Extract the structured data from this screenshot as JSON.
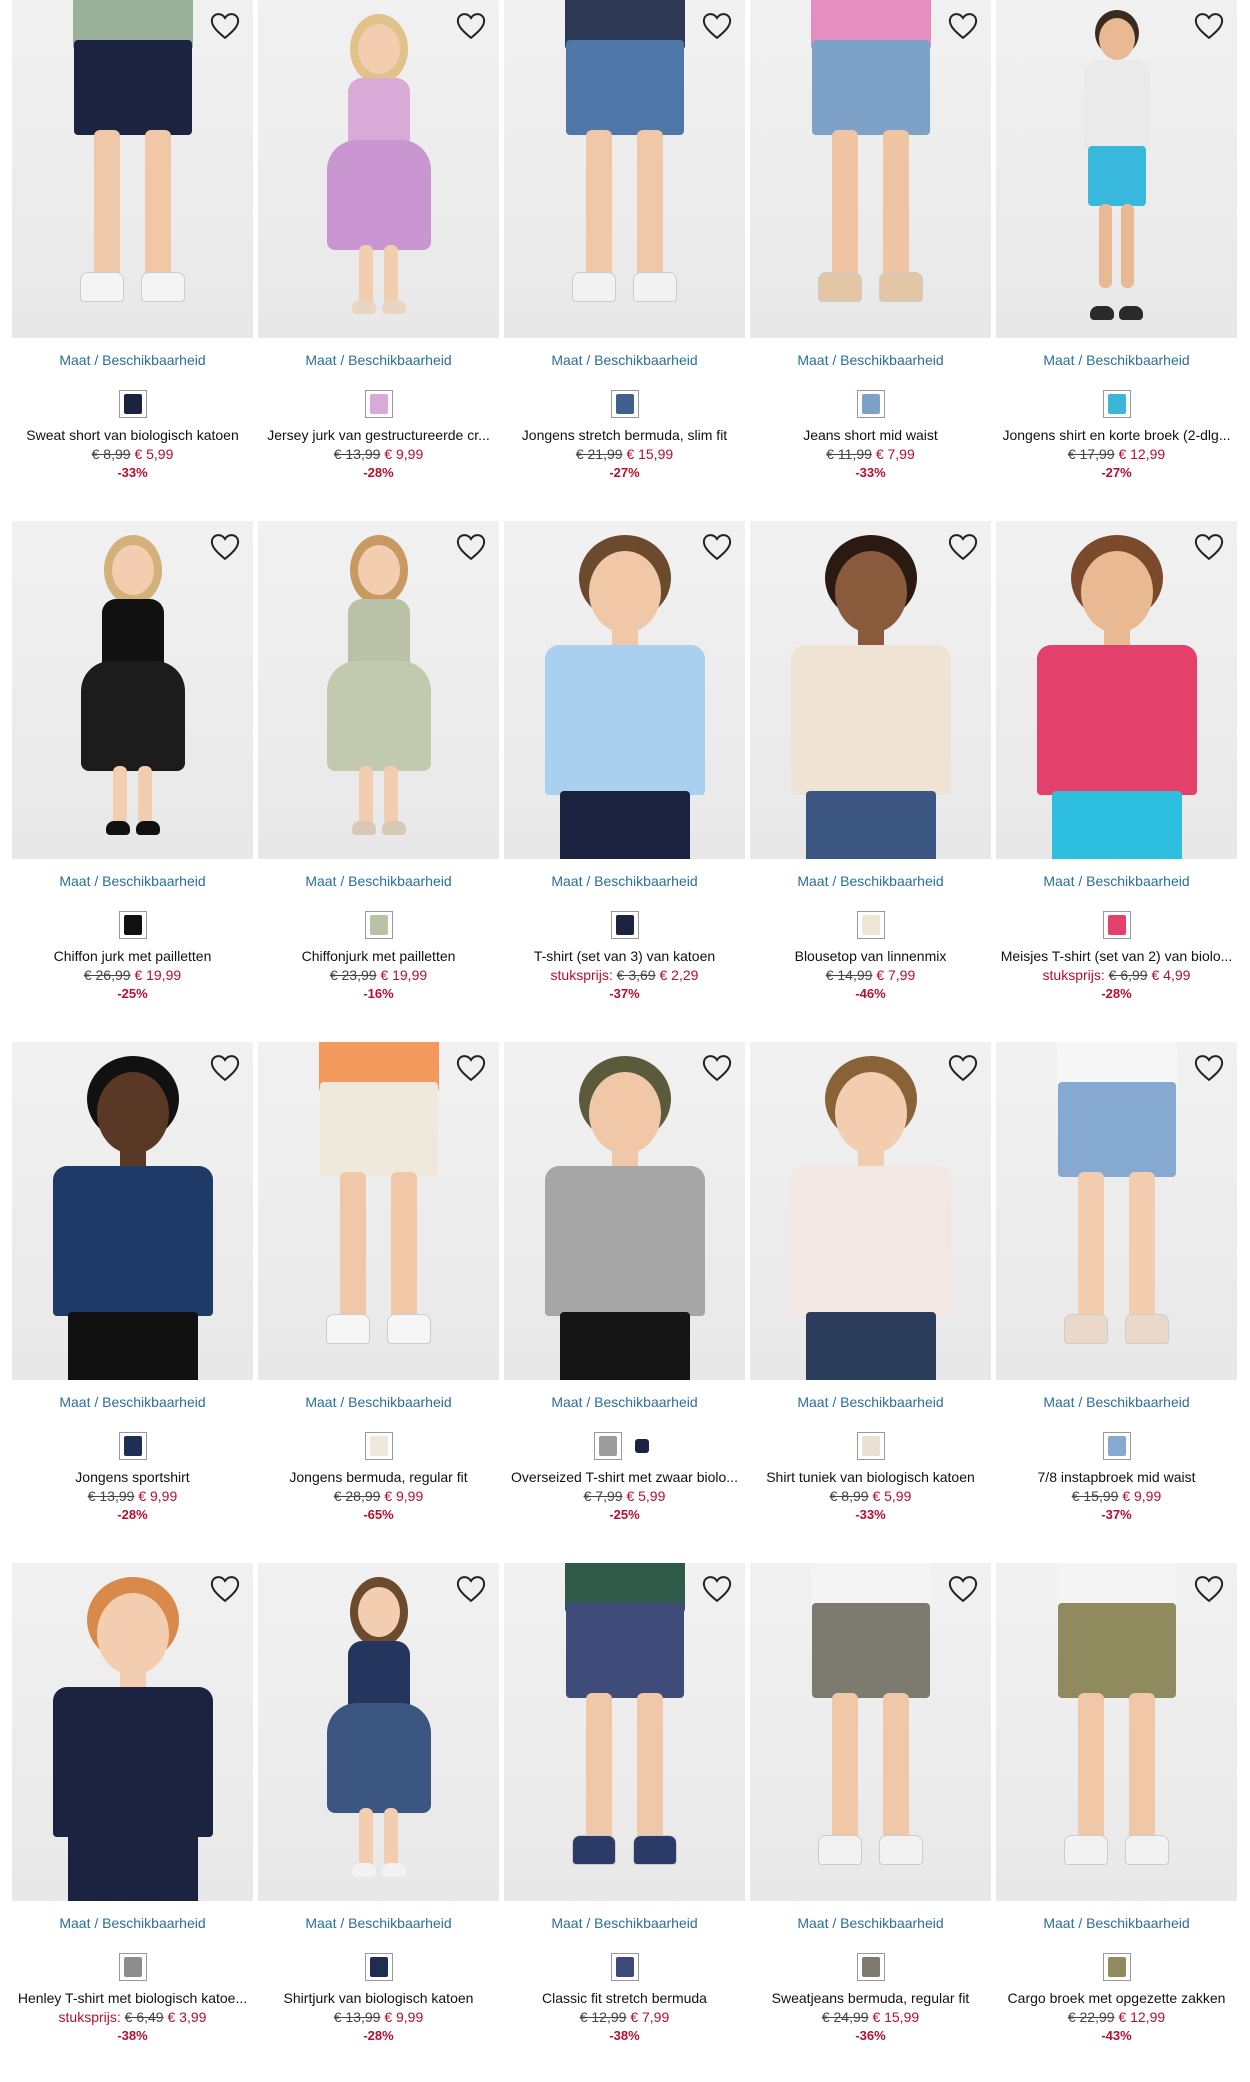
{
  "size_link_label": "Maat / Beschikbaarheid",
  "wishlist_icon": "heart-outline-icon",
  "colors": {
    "accent_link": "#2a6f97",
    "sale_red": "#b2102f"
  },
  "products": [
    {
      "title": "Sweat short van biologisch katoen",
      "price_label": "",
      "old_price": "€ 8,99",
      "new_price": "€ 5,99",
      "discount": "-33%",
      "swatches": [
        "#1c2340"
      ],
      "look": {
        "top": "#9bb09a",
        "bottom": "#1c2340",
        "skin": "#f0c8a8",
        "shoe": "#f4f4f4",
        "hair": "#caa77c",
        "crop": "legs"
      }
    },
    {
      "title": "Jersey jurk van gestructureerde cr...",
      "price_label": "",
      "old_price": "€ 13,99",
      "new_price": "€ 9,99",
      "discount": "-28%",
      "swatches": [
        "#d9a9d8"
      ],
      "look": {
        "top": "#d9a9d8",
        "bottom": "#c996d2",
        "skin": "#f3cdb0",
        "shoe": "#e9d6c2",
        "hair": "#e2c28b",
        "crop": "full-dress"
      }
    },
    {
      "title": "Jongens stretch bermuda, slim fit",
      "price_label": "",
      "old_price": "€ 21,99",
      "new_price": "€ 15,99",
      "discount": "-27%",
      "swatches": [
        "#3f5f8d"
      ],
      "look": {
        "top": "#2e3a55",
        "bottom": "#4f78a9",
        "skin": "#f0c8a8",
        "shoe": "#f2f2f2",
        "hair": "#4a3424",
        "crop": "legs"
      }
    },
    {
      "title": "Jeans short mid waist",
      "price_label": "",
      "old_price": "€ 11,99",
      "new_price": "€ 7,99",
      "discount": "-33%",
      "swatches": [
        "#7ea1c7"
      ],
      "look": {
        "top": "#e58fc0",
        "bottom": "#7ea1c7",
        "skin": "#f0c4a2",
        "shoe": "#e3c7a5",
        "hair": "#caa77c",
        "crop": "legs"
      }
    },
    {
      "title": "Jongens shirt en korte broek (2-dlg...",
      "price_label": "",
      "old_price": "€ 17,99",
      "new_price": "€ 12,99",
      "discount": "-27%",
      "swatches": [
        "#3cb6d8"
      ],
      "look": {
        "top": "#eaeaea",
        "bottom": "#39b8dd",
        "skin": "#e8b993",
        "shoe": "#2a2a2a",
        "hair": "#3a2a1f",
        "crop": "full"
      }
    },
    {
      "title": "Chiffon jurk met pailletten",
      "price_label": "",
      "old_price": "€ 26,99",
      "new_price": "€ 19,99",
      "discount": "-25%",
      "swatches": [
        "#111111"
      ],
      "look": {
        "top": "#111111",
        "bottom": "#1c1c1c",
        "skin": "#f3cdb0",
        "shoe": "#111111",
        "hair": "#d4b07a",
        "crop": "full-dress"
      }
    },
    {
      "title": "Chiffonjurk met pailletten",
      "price_label": "",
      "old_price": "€ 23,99",
      "new_price": "€ 19,99",
      "discount": "-16%",
      "swatches": [
        "#b9c2a6"
      ],
      "look": {
        "top": "#b9c2a6",
        "bottom": "#c1c9ae",
        "skin": "#f3cdb0",
        "shoe": "#d7c9b5",
        "hair": "#c89a62",
        "crop": "full-dress"
      }
    },
    {
      "title": "T-shirt (set van 3) van katoen",
      "price_label": "stuksprijs:",
      "old_price": "€ 3,69",
      "new_price": "€ 2,29",
      "discount": "-37%",
      "swatches": [
        "#1c2340"
      ],
      "look": {
        "top": "#a9d0ef",
        "bottom": "#1c2340",
        "skin": "#f0c8a8",
        "shoe": "#2a2a2a",
        "hair": "#6b4a2e",
        "crop": "upper"
      }
    },
    {
      "title": "Blousetop van linnenmix",
      "price_label": "",
      "old_price": "€ 14,99",
      "new_price": "€ 7,99",
      "discount": "-46%",
      "swatches": [
        "#efe6d6"
      ],
      "look": {
        "top": "#efe4d3",
        "bottom": "#3b5680",
        "skin": "#8a5a3c",
        "shoe": "#2a2a2a",
        "hair": "#2a1a12",
        "crop": "upper"
      }
    },
    {
      "title": "Meisjes T-shirt (set van 2) van biolo...",
      "price_label": "stuksprijs:",
      "old_price": "€ 6,99",
      "new_price": "€ 4,99",
      "discount": "-28%",
      "swatches": [
        "#e4406c"
      ],
      "look": {
        "top": "#e4406c",
        "bottom": "#2ebee0",
        "skin": "#e8b993",
        "shoe": "#f2f2f2",
        "hair": "#7a4a2a",
        "crop": "upper"
      }
    },
    {
      "title": "Jongens sportshirt",
      "price_label": "",
      "old_price": "€ 13,99",
      "new_price": "€ 9,99",
      "discount": "-28%",
      "swatches": [
        "#1d2f52"
      ],
      "look": {
        "top": "#1d3b66",
        "bottom": "#111111",
        "skin": "#5a3826",
        "shoe": "#111111",
        "hair": "#111111",
        "crop": "upper"
      }
    },
    {
      "title": "Jongens bermuda, regular fit",
      "price_label": "",
      "old_price": "€ 28,99",
      "new_price": "€ 9,99",
      "discount": "-65%",
      "swatches": [
        "#efe9dc"
      ],
      "look": {
        "top": "#f29a5c",
        "bottom": "#efe9dc",
        "skin": "#f0c8a8",
        "shoe": "#f6f6f6",
        "hair": "#6b4a2e",
        "crop": "legs"
      }
    },
    {
      "title": "Overseized T-shirt met zwaar biolo...",
      "price_label": "",
      "old_price": "€ 7,99",
      "new_price": "€ 5,99",
      "discount": "-25%",
      "swatches": [
        "#9c9c9c",
        "#1c2340"
      ],
      "look": {
        "top": "#a6a6a6",
        "bottom": "#151515",
        "skin": "#f0c8a8",
        "shoe": "#2a2a2a",
        "hair": "#5c5a3c",
        "crop": "upper"
      }
    },
    {
      "title": "Shirt tuniek van biologisch katoen",
      "price_label": "",
      "old_price": "€ 8,99",
      "new_price": "€ 5,99",
      "discount": "-33%",
      "swatches": [
        "#e9e2d2"
      ],
      "look": {
        "top": "#f2e7e2",
        "bottom": "#2c3d5c",
        "skin": "#f3cdb0",
        "shoe": "#2a2a2a",
        "hair": "#8a6238",
        "crop": "upper"
      }
    },
    {
      "title": "7/8 instapbroek mid waist",
      "price_label": "",
      "old_price": "€ 15,99",
      "new_price": "€ 9,99",
      "discount": "-37%",
      "swatches": [
        "#86a9d2"
      ],
      "look": {
        "top": "#f6f6f6",
        "bottom": "#86a9d2",
        "skin": "#f3cdb0",
        "shoe": "#ead8c9",
        "hair": "#c89a62",
        "crop": "legs"
      }
    },
    {
      "title": "Henley T-shirt met biologisch katoe...",
      "price_label": "stuksprijs:",
      "old_price": "€ 6,49",
      "new_price": "€ 3,99",
      "discount": "-38%",
      "swatches": [
        "#8d8d8d"
      ],
      "look": {
        "top": "#1c2340",
        "bottom": "#1c2340",
        "skin": "#f3cdb0",
        "shoe": "#2a2a2a",
        "hair": "#d98a4a",
        "crop": "upper"
      }
    },
    {
      "title": "Shirtjurk van biologisch katoen",
      "price_label": "",
      "old_price": "€ 13,99",
      "new_price": "€ 9,99",
      "discount": "-28%",
      "swatches": [
        "#1f2d4f"
      ],
      "look": {
        "top": "#24365e",
        "bottom": "#3b5680",
        "skin": "#f3cdb0",
        "shoe": "#f2f2f2",
        "hair": "#6b4a2e",
        "crop": "full-dress"
      }
    },
    {
      "title": "Classic fit stretch bermuda",
      "price_label": "",
      "old_price": "€ 12,99",
      "new_price": "€ 7,99",
      "discount": "-38%",
      "swatches": [
        "#3b4a7a"
      ],
      "look": {
        "top": "#2f5a4a",
        "bottom": "#3f4b78",
        "skin": "#f0c8a8",
        "shoe": "#2b3a66",
        "hair": "#6b4a2e",
        "crop": "legs"
      }
    },
    {
      "title": "Sweatjeans bermuda, regular fit",
      "price_label": "",
      "old_price": "€ 24,99",
      "new_price": "€ 15,99",
      "discount": "-36%",
      "swatches": [
        "#7d7a70"
      ],
      "look": {
        "top": "#f4f4f4",
        "bottom": "#7d7a70",
        "skin": "#f0c8a8",
        "shoe": "#f2f2f2",
        "hair": "#3a2a1f",
        "crop": "legs"
      }
    },
    {
      "title": "Cargo broek met opgezette zakken",
      "price_label": "",
      "old_price": "€ 22,99",
      "new_price": "€ 12,99",
      "discount": "-43%",
      "swatches": [
        "#8f8b5e"
      ],
      "look": {
        "top": "#f4f4f4",
        "bottom": "#8f8b5e",
        "skin": "#f0c8a8",
        "shoe": "#f2f2f2",
        "hair": "#3a2a1f",
        "crop": "legs"
      }
    }
  ]
}
